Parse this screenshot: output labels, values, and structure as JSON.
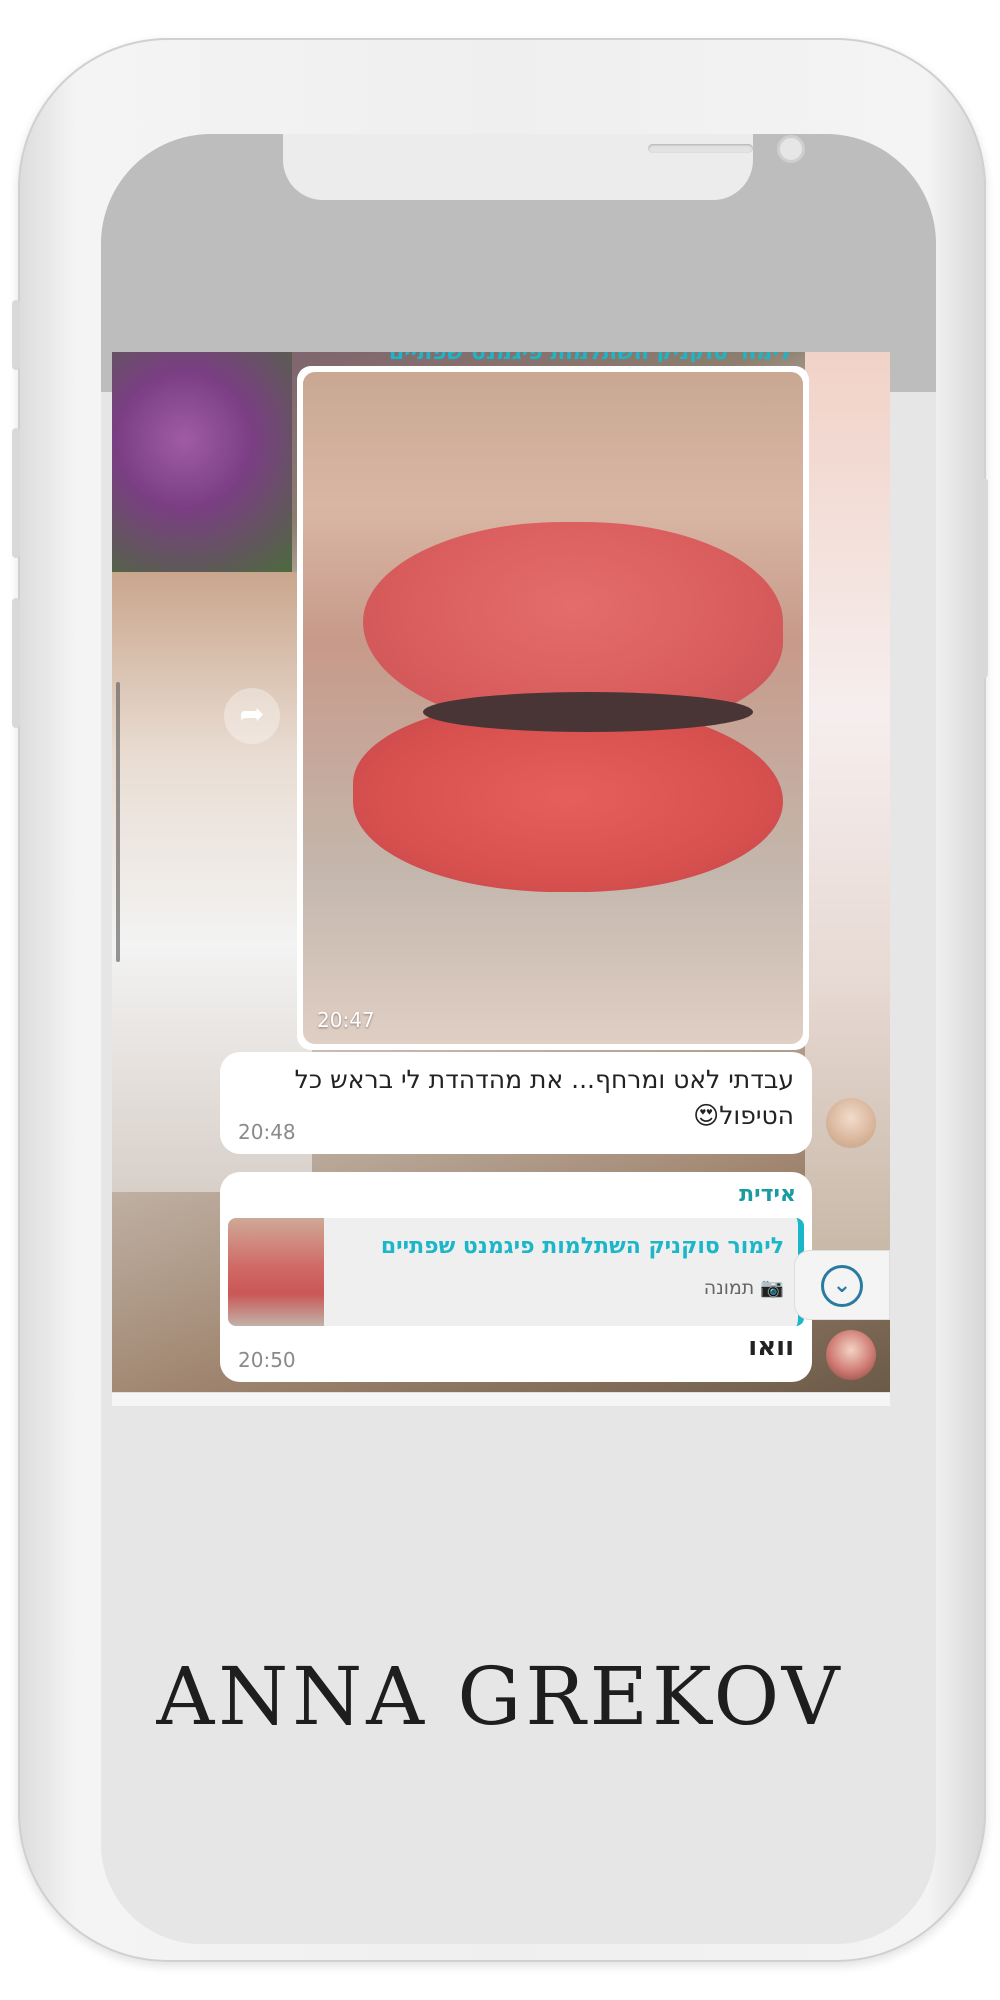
{
  "chat": {
    "cut_header": "לימור סוקניק השתלמות פיגמנט שפתיים",
    "image_message": {
      "time": "20:47"
    },
    "message1": {
      "text": "עבדתי לאט ומרחף... את מהדהדת לי בראש כל הטיפול😍",
      "time": "20:48"
    },
    "message2": {
      "sender": "אידית",
      "quote_title": "לימור סוקניק השתלמות פיגמנט שפתיים",
      "quote_sub": "📷 תמונה",
      "text": "וואו",
      "time": "20:50"
    }
  },
  "brand": {
    "name": "ANNA GREKOV"
  },
  "colors": {
    "accent": "#1bb6c8",
    "sender": "#1a9aa3",
    "icon_blue": "#2a7ba1"
  },
  "icons": [
    "share-icon",
    "chevron-down-icon",
    "camera-icon"
  ]
}
